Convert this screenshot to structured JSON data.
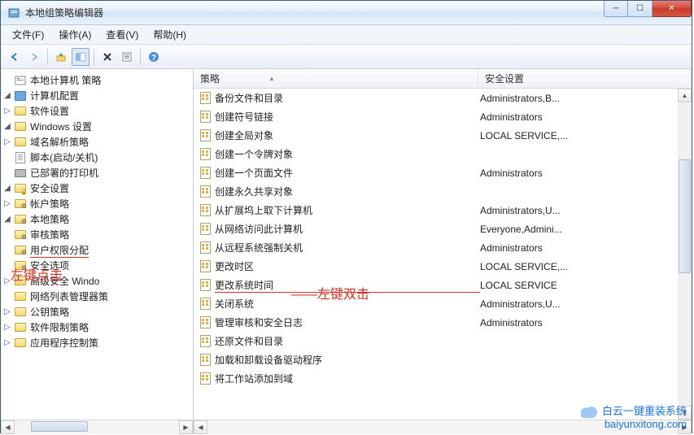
{
  "window": {
    "title": "本地组策略编辑器"
  },
  "menu": {
    "file": "文件(F)",
    "action": "操作(A)",
    "view": "查看(V)",
    "help": "帮助(H)"
  },
  "toolbar_icons": {
    "back": "back-arrow",
    "forward": "forward-arrow",
    "up": "up-folder",
    "show_hide": "show-hide-tree",
    "delete": "delete",
    "props": "properties",
    "help": "help"
  },
  "tree": {
    "root": "本地计算机 策略",
    "computer_config": "计算机配置",
    "software_settings": "软件设置",
    "windows_settings": "Windows 设置",
    "dns_policy": "域名解析策略",
    "scripts": "脚本(启动/关机)",
    "deployed_printers": "已部署的打印机",
    "security_settings": "安全设置",
    "account_policy": "帐户策略",
    "local_policy": "本地策略",
    "audit_policy": "审核策略",
    "user_rights": "用户权限分配",
    "security_options": "安全选项",
    "adv_sec_windows": "高级安全 Windo",
    "nlm_policy": "网络列表管理器策",
    "pubkey_policy": "公钥策略",
    "software_restrict": "软件限制策略",
    "app_control": "应用程序控制策"
  },
  "columns": {
    "policy": "策略",
    "security_setting": "安全设置"
  },
  "policies": [
    {
      "name": "备份文件和目录",
      "value": "Administrators,B..."
    },
    {
      "name": "创建符号链接",
      "value": "Administrators"
    },
    {
      "name": "创建全局对象",
      "value": "LOCAL SERVICE,..."
    },
    {
      "name": "创建一个令牌对象",
      "value": ""
    },
    {
      "name": "创建一个页面文件",
      "value": "Administrators"
    },
    {
      "name": "创建永久共享对象",
      "value": ""
    },
    {
      "name": "从扩展坞上取下计算机",
      "value": "Administrators,U..."
    },
    {
      "name": "从网络访问此计算机",
      "value": "Everyone,Admini..."
    },
    {
      "name": "从远程系统强制关机",
      "value": "Administrators"
    },
    {
      "name": "更改时区",
      "value": "LOCAL SERVICE,..."
    },
    {
      "name": "更改系统时间",
      "value": "LOCAL SERVICE"
    },
    {
      "name": "关闭系统",
      "value": "Administrators,U..."
    },
    {
      "name": "管理审核和安全日志",
      "value": "Administrators"
    },
    {
      "name": "还原文件和目录",
      "value": ""
    },
    {
      "name": "加载和卸载设备驱动程序",
      "value": ""
    },
    {
      "name": "将工作站添加到域",
      "value": ""
    }
  ],
  "annotations": {
    "left_click": "左键点击",
    "double_click": "左键双击",
    "dash": "——"
  },
  "watermark": {
    "line1": "白云一键重装系统",
    "line2": "baiyunxitong.com"
  }
}
